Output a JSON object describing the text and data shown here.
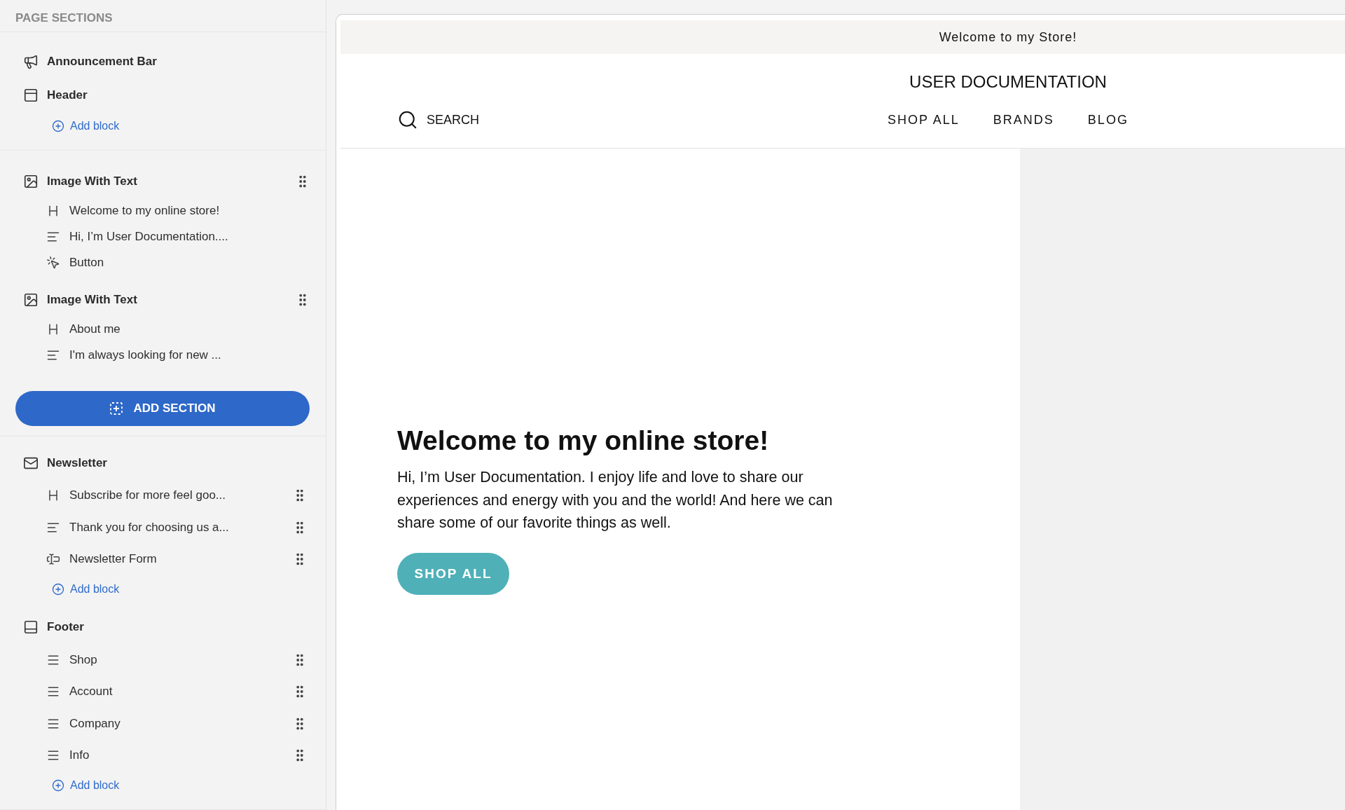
{
  "sidebar": {
    "title": "PAGE SECTIONS",
    "groups": [
      {
        "sections": [
          {
            "kind": "announcement",
            "label": "Announcement Bar",
            "draggable": false
          },
          {
            "kind": "header",
            "label": "Header",
            "draggable": false,
            "add_block": "Add block"
          }
        ]
      },
      {
        "sections": [
          {
            "kind": "image",
            "label": "Image With Text",
            "draggable": true,
            "blocks": [
              {
                "kind": "heading",
                "label": "Welcome to my online store!",
                "draggable": false
              },
              {
                "kind": "text",
                "label": "Hi, I’m User Documentation....",
                "draggable": false
              },
              {
                "kind": "button",
                "label": "Button",
                "draggable": false
              }
            ]
          },
          {
            "kind": "image",
            "label": "Image With Text",
            "draggable": true,
            "blocks": [
              {
                "kind": "heading",
                "label": "About me",
                "draggable": false
              },
              {
                "kind": "text",
                "label": "I'm always looking for new ...",
                "draggable": false
              }
            ]
          }
        ],
        "add_section": "ADD SECTION"
      },
      {
        "sections": [
          {
            "kind": "newsletter",
            "label": "Newsletter",
            "draggable": false,
            "blocks": [
              {
                "kind": "heading",
                "label": "Subscribe for more feel goo...",
                "draggable": true
              },
              {
                "kind": "text",
                "label": "Thank you for choosing us a...",
                "draggable": true
              },
              {
                "kind": "form",
                "label": "Newsletter Form",
                "draggable": true
              }
            ],
            "add_block": "Add block"
          },
          {
            "kind": "footer",
            "label": "Footer",
            "draggable": false,
            "blocks": [
              {
                "kind": "menu",
                "label": "Shop",
                "draggable": true
              },
              {
                "kind": "menu",
                "label": "Account",
                "draggable": true
              },
              {
                "kind": "menu",
                "label": "Company",
                "draggable": true
              },
              {
                "kind": "menu",
                "label": "Info",
                "draggable": true
              }
            ],
            "add_block": "Add block"
          }
        ]
      }
    ]
  },
  "preview": {
    "announcement": "Welcome to my Store!",
    "store_title": "USER DOCUMENTATION",
    "search": "SEARCH",
    "nav": [
      "SHOP ALL",
      "BRANDS",
      "BLOG"
    ],
    "hero": {
      "heading": "Welcome to my online store!",
      "body": "Hi, I’m User Documentation. I enjoy life and love to share our experiences and energy with you and the world! And here we can share some of our favorite things as well.",
      "button": "SHOP ALL"
    }
  }
}
